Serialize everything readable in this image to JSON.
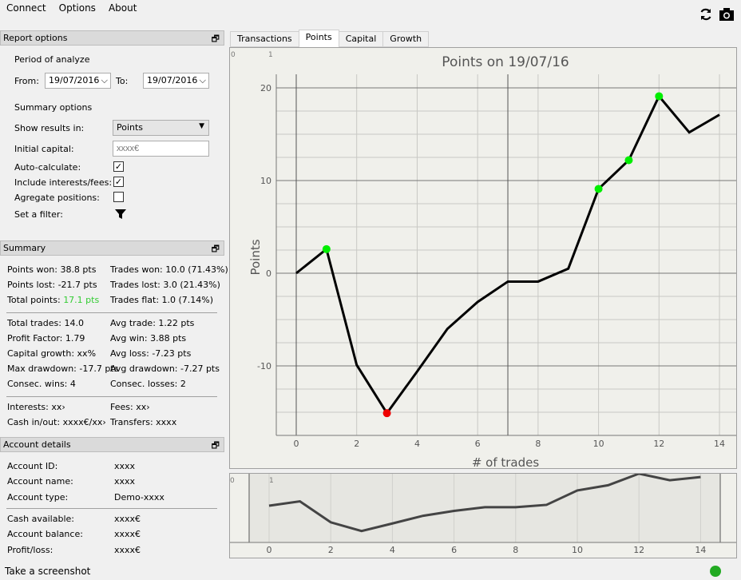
{
  "menu": [
    "Connect",
    "Options",
    "About"
  ],
  "toolbar": {
    "icons": [
      "refresh-icon",
      "camera-icon"
    ]
  },
  "report_options": {
    "title": "Report options",
    "period_label": "Period of analyze",
    "from_label": "From:",
    "from_value": "19/07/2016",
    "to_label": "To:",
    "to_value": "19/07/2016",
    "summary_label": "Summary options",
    "show_results_label": "Show results in:",
    "show_results_value": "Points",
    "initial_capital_label": "Initial capital:",
    "initial_capital_placeholder": "xxxx€",
    "auto_calc_label": "Auto-calculate:",
    "auto_calc": true,
    "include_fees_label": "Include interests/fees:",
    "include_fees": true,
    "aggregate_label": "Agregate positions:",
    "aggregate": false,
    "filter_label": "Set a filter:"
  },
  "summary": {
    "title": "Summary",
    "group1": [
      [
        "Points won: 38.8 pts",
        "Trades won: 10.0 (71.43%)"
      ],
      [
        "Points lost: -21.7 pts",
        "Trades lost: 3.0 (21.43%)"
      ],
      [
        "Total points: ",
        "Trades flat: 1.0 (7.14%)"
      ]
    ],
    "total_points_value": "17.1 pts",
    "group2": [
      [
        "Total trades: 14.0",
        "Avg trade: 1.22 pts"
      ],
      [
        "Profit Factor: 1.79",
        "Avg win: 3.88 pts"
      ],
      [
        "Capital growth: xx%",
        "Avg loss: -7.23 pts"
      ],
      [
        "Max drawdown: -17.7 pts",
        "Avg drawdown: -7.27 pts"
      ],
      [
        "Consec. wins: 4",
        "Consec. losses: 2"
      ]
    ],
    "group3": [
      [
        "Interests: xx›",
        "Fees: xx›"
      ],
      [
        "Cash in/out: xxxx€/xx›",
        "Transfers: xxxx"
      ]
    ]
  },
  "account": {
    "title": "Account details",
    "group1": [
      [
        "Account ID:",
        "xxxx"
      ],
      [
        "Account name:",
        "xxxx"
      ],
      [
        "Account type:",
        "Demo-xxxx"
      ]
    ],
    "group2": [
      [
        "Cash available:",
        "xxxx€"
      ],
      [
        "Account balance:",
        "xxxx€"
      ],
      [
        "Profit/loss:",
        "xxxx€"
      ]
    ]
  },
  "tabs": [
    "Transactions",
    "Points",
    "Capital",
    "Growth"
  ],
  "active_tab": "Points",
  "status": {
    "text": "Take a screenshot",
    "indicator_color": "#22aa22"
  },
  "colors": {
    "win": "#00ee00",
    "loss": "#ee0000",
    "total_points": "#33cc33"
  },
  "chart_data": {
    "type": "line",
    "title": "Points on 19/07/16",
    "xlabel": "# of trades",
    "ylabel": "Points",
    "x": [
      0,
      1,
      2,
      3,
      4,
      5,
      6,
      7,
      8,
      9,
      10,
      11,
      12,
      13,
      14
    ],
    "values": [
      0,
      2.6,
      -9.9,
      -15.1,
      -10.6,
      -6.0,
      -3.1,
      -0.9,
      -0.9,
      0.5,
      9.1,
      12.2,
      19.1,
      15.2,
      17.1
    ],
    "win_markers": [
      1,
      10,
      11,
      12
    ],
    "loss_markers": [
      3
    ],
    "xticks": [
      0,
      2,
      4,
      6,
      8,
      10,
      12,
      14
    ],
    "yticks": [
      -10,
      0,
      10,
      20
    ],
    "xlim": [
      -0.6,
      14.6
    ],
    "ylim": [
      -17.5,
      23
    ],
    "cursor_x": 7,
    "corner_labels": [
      "0",
      "1"
    ]
  }
}
